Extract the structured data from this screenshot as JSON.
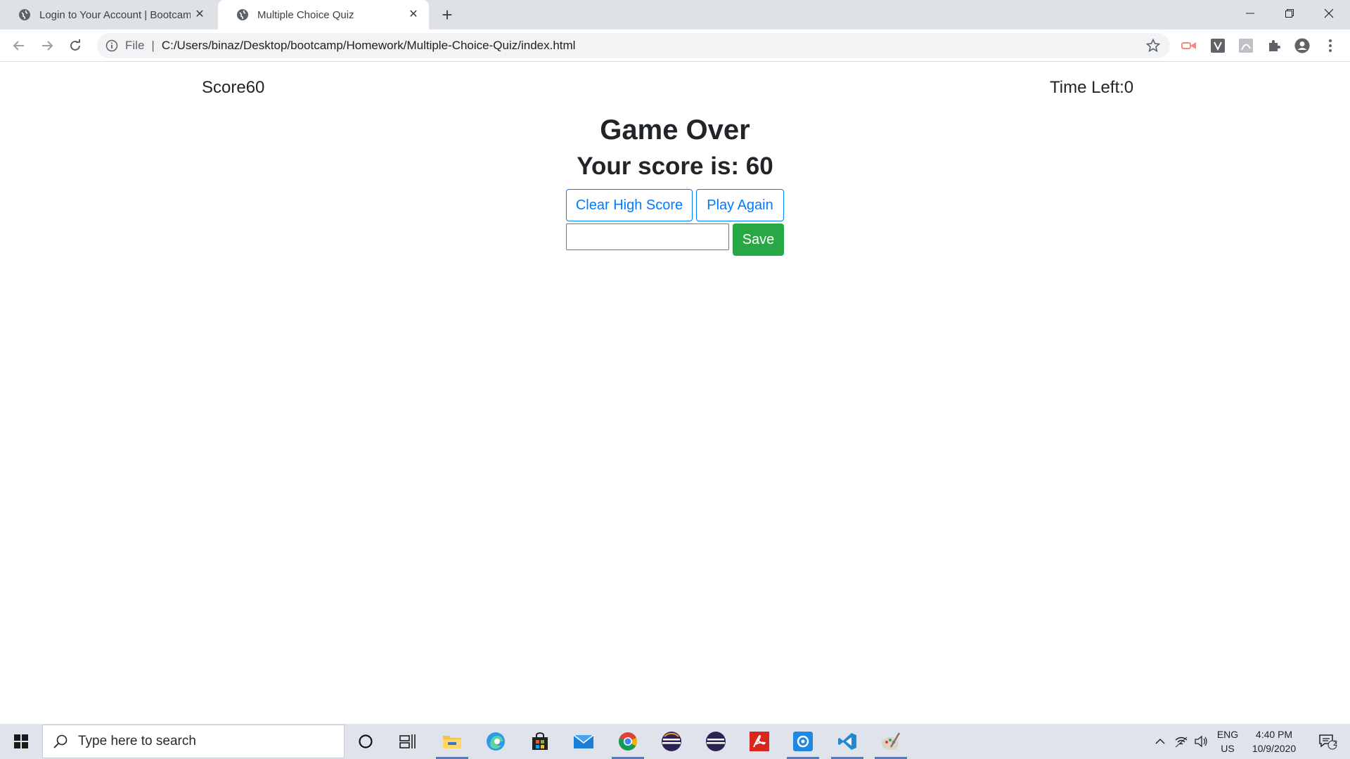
{
  "browser": {
    "tabs": [
      {
        "title": "Login to Your Account | Bootcamp Spot",
        "active": false
      },
      {
        "title": "Multiple Choice Quiz",
        "active": true
      }
    ],
    "address": {
      "scheme_label": "File",
      "url": "C:/Users/binaz/Desktop/bootcamp/Homework/Multiple-Choice-Quiz/index.html"
    }
  },
  "page": {
    "score_label": "Score60",
    "time_label": "Time Left:0",
    "game_over_title": "Game Over",
    "score_heading": "Your score is: 60",
    "clear_button": "Clear High Score",
    "play_again_button": "Play Again",
    "name_input_value": "",
    "save_button": "Save"
  },
  "taskbar": {
    "search_placeholder": "Type here to search",
    "language_top": "ENG",
    "language_bottom": "US",
    "time": "4:40 PM",
    "date": "10/9/2020",
    "notification_count": "2"
  },
  "colors": {
    "primary_outline": "#007bff",
    "save_green": "#28a745",
    "text_dark": "#212529"
  }
}
